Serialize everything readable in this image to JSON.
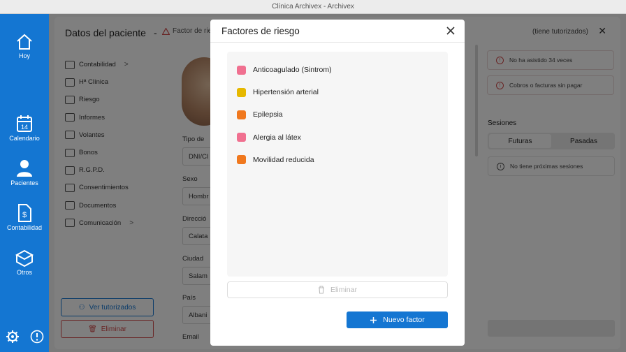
{
  "window": {
    "title": "Clínica Archivex - Archivex"
  },
  "sidebar": {
    "items": [
      {
        "label": "Hoy",
        "icon": "home-icon"
      },
      {
        "label": "Calendario",
        "icon": "calendar-icon",
        "badge": "14"
      },
      {
        "label": "Pacientes",
        "icon": "person-icon"
      },
      {
        "label": "Contabilidad",
        "icon": "invoice-icon"
      },
      {
        "label": "Otros",
        "icon": "box-icon"
      }
    ],
    "bottom_icons": [
      "gear-icon",
      "alert-icon"
    ],
    "accent": "#1476d2"
  },
  "background": {
    "title": "Datos del paciente",
    "separator": "-",
    "risk_label": "Factor de ries",
    "tutor_label": "(tiene tutorizados)",
    "menu": [
      {
        "label": "Contabilidad",
        "chevron": ">"
      },
      {
        "label": "Hª Clínica"
      },
      {
        "label": "Riesgo"
      },
      {
        "label": "Informes"
      },
      {
        "label": "Volantes"
      },
      {
        "label": "Bonos"
      },
      {
        "label": "R.G.P.D."
      },
      {
        "label": "Consentimientos"
      },
      {
        "label": "Documentos"
      },
      {
        "label": "Comunicación",
        "chevron": ">"
      }
    ],
    "btn_tutorizados": "Ver tutorizados",
    "btn_eliminar": "Eliminar",
    "fields": [
      {
        "label": "Tipo de",
        "value": "DNI/Cl"
      },
      {
        "label": "Sexo",
        "value": "Hombr"
      },
      {
        "label": "Direcció",
        "value": "Calata"
      },
      {
        "label": "Ciudad",
        "value": "Salam"
      },
      {
        "label": "País",
        "value": "Albani"
      },
      {
        "label": "Email",
        "value": ""
      }
    ],
    "alerts": [
      "No ha asistido 34 veces",
      "Cobros o facturas sin pagar"
    ],
    "sessions_title": "Sesiones",
    "tabs": [
      "Futuras",
      "Pasadas"
    ],
    "no_sessions": "No tiene próximas sesiones"
  },
  "modal": {
    "title": "Factores de riesgo",
    "factors": [
      {
        "label": "Anticoagulado (Sintrom)",
        "color": "#f07090"
      },
      {
        "label": "Hipertensión arterial",
        "color": "#e6b800"
      },
      {
        "label": "Epilepsia",
        "color": "#f0781e"
      },
      {
        "label": "Alergia al látex",
        "color": "#f07090"
      },
      {
        "label": "Movilidad reducida",
        "color": "#f0781e"
      }
    ],
    "delete_label": "Eliminar",
    "new_label": "Nuevo factor"
  }
}
